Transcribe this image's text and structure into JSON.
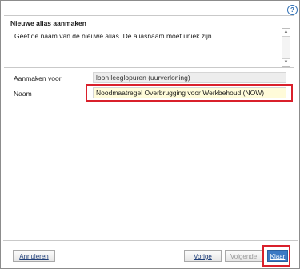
{
  "dialog": {
    "help_icon": "question-mark-icon",
    "header": {
      "title": "Nieuwe alias aanmaken",
      "description": "Geef de naam van de nieuwe alias. De aliasnaam moet uniek zijn."
    },
    "scrollbar": {
      "up_glyph": "▲",
      "down_glyph": "▼"
    },
    "form": {
      "create_for_label": "Aanmaken voor",
      "create_for_value": "loon leeglopuren (uurverloning)",
      "name_label": "Naam",
      "name_value": "Noodmaatregel Overbrugging voor Werkbehoud (NOW)"
    },
    "footer": {
      "cancel_label": "Annuleren",
      "previous_label": "Vorige",
      "next_label": "Volgende",
      "finish_label": "Klaar"
    },
    "colors": {
      "highlight": "#d9202b",
      "primary_button": "#3b79c4",
      "name_field_bg": "#fffbd9"
    }
  }
}
